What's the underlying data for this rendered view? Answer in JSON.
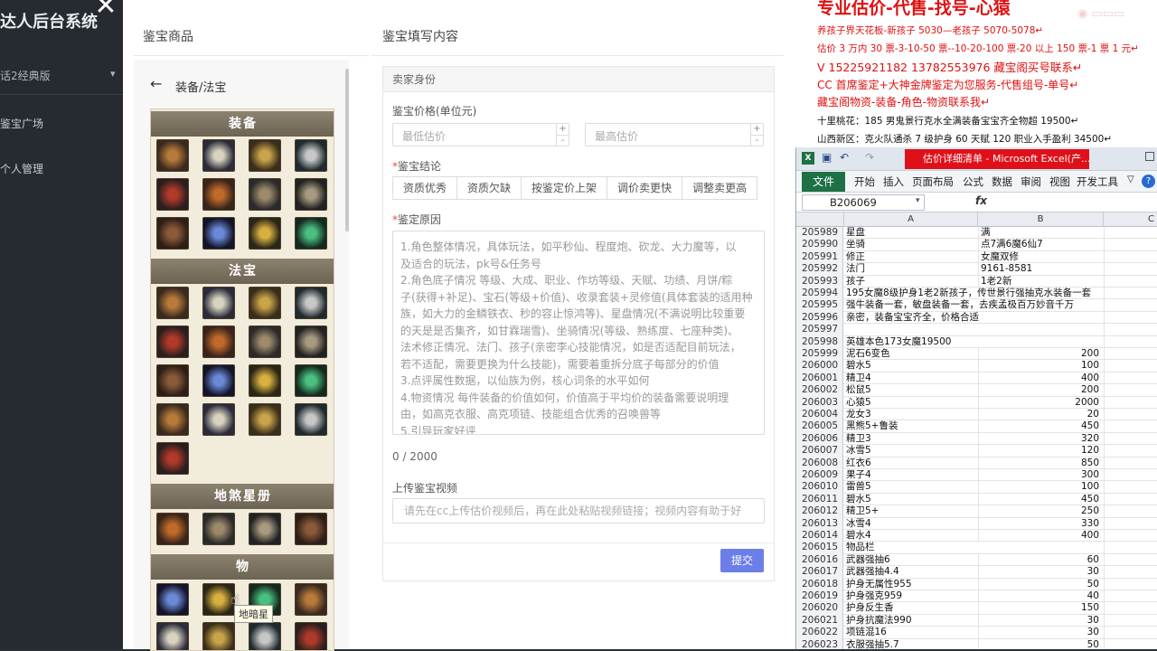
{
  "sidebar": {
    "title": "达人后台系统",
    "version": "话2经典版",
    "nav": [
      "鉴宝广场",
      "个人管理"
    ]
  },
  "modal": {
    "left_header": "鉴宝商品",
    "right_header": "鉴宝填写内容",
    "breadcrumb": "装备/法宝",
    "categories": {
      "equip": "装备",
      "fabao": "法宝",
      "star": "地煞星册",
      "wu": "物"
    },
    "tooltip": "地暗星"
  },
  "form": {
    "section": "卖家身份",
    "price_label": "鉴宝价格(单位元)",
    "min_placeholder": "最低估价",
    "max_placeholder": "最高估价",
    "conclusion_label": "鉴宝结论",
    "conclusion_options": [
      "资质优秀",
      "资质欠缺",
      "按鉴定价上架",
      "调价卖更快",
      "调整卖更高"
    ],
    "reason_label": "鉴定原因",
    "reason_lines": [
      "1.角色整体情况，具体玩法，如平秒仙、程度炮、砍龙、大力魔等，以",
      "及适合的玩法，pk号&任务号",
      "2.角色底子情况 等级、大成、职业、作坊等级、天赋、功绩、月饼/粽",
      "子(获得+补足)、宝石(等级+价值)、收录套装+灵修值(具体套装的适用种",
      "族，如大力的金鳞铁衣、秒的容止惊鸿等)、星盘情况(不满说明比较重要",
      "的天是是否集齐，如甘霖瑞雪)、坐骑情况(等级、熟练度、七座种类)、",
      "法术修正情况、法门、孩子(亲密李心技能情况，如是否适配目前玩法，",
      "若不适配，需要更换为什么技能)，需要着重拆分底子每部分的价值",
      "3.点评属性数据，以仙族为例，核心词条的水平如何",
      "4.物资情况 每件装备的价值如何，价值高于平均价的装备需要说明理",
      "由，如高克衣服、高克项链、技能组合优秀的召唤兽等",
      "5.引导玩家好评"
    ],
    "counter": "0 / 2000",
    "video_label": "上传鉴宝视频",
    "video_placeholder": "请先在cc上传估价视频后，再在此处粘贴视频链接；视频内容有助于好",
    "submit": "提交"
  },
  "ad": {
    "title": "专业估价-代售-找号-心猿",
    "lines": [
      {
        "text": "养孩子界天花板-新孩子 5030—老孩子 5070-5078↵",
        "color": "#e01010"
      },
      {
        "text": "估价 3 万内 30 票-3-10-50 票--10-20-100 票-20 以上 150 票-1 票 1 元↵",
        "color": "#e01010"
      },
      {
        "text": "V 15225921182      13782553976    藏宝阁买号联系↵",
        "color": "#e01010"
      },
      {
        "text": "CC 首席鉴定+大神金牌鉴定为您服务-代售组号-单号↵",
        "color": "#e01010"
      },
      {
        "text": "藏宝阁物资-装备-角色-物资联系我↵",
        "color": "#e01010"
      },
      {
        "text": "十里桃花：185 男鬼景行克水全满装备宝宝齐全物超 19500↵",
        "color": "#111111"
      },
      {
        "text": "山西新区：克火队通杀 7 级护身 60 天赋 120 职业入手盈利 34500↵",
        "color": "#111111"
      }
    ]
  },
  "excel": {
    "window_title": "估价详细清单 - Microsoft Excel(产...",
    "ribbon_file": "文件",
    "ribbon_tabs": [
      "开始",
      "插入",
      "页面布局",
      "公式",
      "数据",
      "审阅",
      "视图",
      "开发工具"
    ],
    "name_box": "B206069",
    "fx": "fx",
    "columns": [
      "A",
      "B",
      "C"
    ],
    "rows": [
      [
        "205989",
        "星盘",
        "满",
        ""
      ],
      [
        "205990",
        "坐骑",
        "点7满6魔6仙7",
        ""
      ],
      [
        "205991",
        "修正",
        "女魔双修",
        ""
      ],
      [
        "205992",
        "法门",
        "9161-8581",
        ""
      ],
      [
        "205993",
        "孩子",
        "1老2新",
        ""
      ],
      [
        "205994",
        "195女魔8级护身1老2新孩子，传世景行强抽克水装备一套",
        "",
        ""
      ],
      [
        "205995",
        "强牛装备一套，敏盘装备一套，去疾孟极百万妙音千万",
        "",
        ""
      ],
      [
        "205996",
        "亲密，装备宝宝齐全，价格合适",
        "",
        ""
      ],
      [
        "205997",
        "",
        "",
        ""
      ],
      [
        "205998",
        "英雄本色173女魔19500",
        "",
        ""
      ],
      [
        "205999",
        "泥石6变色",
        "200",
        ""
      ],
      [
        "206000",
        "碧水5",
        "100",
        ""
      ],
      [
        "206001",
        "精卫4",
        "400",
        ""
      ],
      [
        "206002",
        "松鼠5",
        "200",
        ""
      ],
      [
        "206003",
        "心猿5",
        "2000",
        ""
      ],
      [
        "206004",
        "龙女3",
        "20",
        ""
      ],
      [
        "206005",
        "黑熊5+鲁装",
        "450",
        ""
      ],
      [
        "206006",
        "精卫3",
        "320",
        ""
      ],
      [
        "206007",
        "冰雪5",
        "120",
        ""
      ],
      [
        "206008",
        "红衣6",
        "850",
        ""
      ],
      [
        "206009",
        "果子4",
        "300",
        ""
      ],
      [
        "206010",
        "雷兽5",
        "100",
        ""
      ],
      [
        "206011",
        "碧水5",
        "450",
        ""
      ],
      [
        "206012",
        "精卫5+",
        "250",
        ""
      ],
      [
        "206013",
        "冰雪4",
        "330",
        ""
      ],
      [
        "206014",
        "碧水4",
        "400",
        ""
      ],
      [
        "206015",
        "物品栏",
        "",
        ""
      ],
      [
        "206016",
        "武器强抽6",
        "60",
        ""
      ],
      [
        "206017",
        "武器强抽4.4",
        "30",
        ""
      ],
      [
        "206018",
        "护身无属性955",
        "50",
        ""
      ],
      [
        "206019",
        "护身强克959",
        "40",
        ""
      ],
      [
        "206020",
        "护身反生香",
        "150",
        ""
      ],
      [
        "206021",
        "护身抗魔法990",
        "30",
        ""
      ],
      [
        "206022",
        "项链混16",
        "30",
        ""
      ],
      [
        "206023",
        "衣服强抽5.7",
        "50",
        ""
      ]
    ]
  },
  "colors": {
    "accent": "#6c7fe8",
    "excel_green": "#1e7145",
    "ad_red": "#e01010"
  }
}
